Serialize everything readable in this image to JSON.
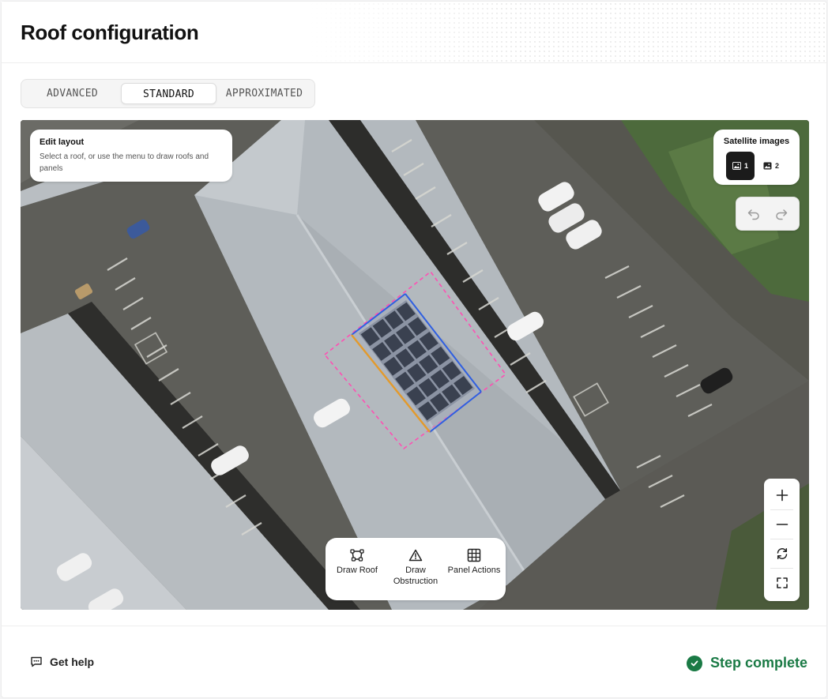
{
  "page": {
    "title": "Roof configuration"
  },
  "mode_tabs": [
    {
      "label": "ADVANCED",
      "active": false
    },
    {
      "label": "STANDARD",
      "active": true
    },
    {
      "label": "APPROXIMATED",
      "active": false
    }
  ],
  "edit_layout": {
    "title": "Edit layout",
    "description": "Select a roof, or use the menu to draw roofs and panels"
  },
  "satellite": {
    "title": "Satellite images",
    "images": [
      {
        "label": "1",
        "icon": "image-icon",
        "active": true
      },
      {
        "label": "2",
        "icon": "image-icon",
        "active": false
      }
    ]
  },
  "history": {
    "undo_icon": "undo-icon",
    "redo_icon": "redo-icon"
  },
  "zoom_controls": [
    "plus-icon",
    "minus-icon",
    "rotate-icon",
    "fullscreen-icon"
  ],
  "tools": [
    {
      "label": "Draw Roof",
      "icon": "roof-polygon-icon"
    },
    {
      "label": "Draw Obstruction",
      "icon": "warning-triangle-icon"
    },
    {
      "label": "Panel Actions",
      "icon": "grid-icon"
    }
  ],
  "solar_array": {
    "rows": 6,
    "columns": 4,
    "panel_color": "#3a4150",
    "outline_color": "#2f5fe0",
    "eave_color": "#e39a2c",
    "setback_color": "#ff4fb3"
  },
  "footer": {
    "help_label": "Get help",
    "step_label": "Step complete",
    "status_color": "#1a7a45"
  }
}
